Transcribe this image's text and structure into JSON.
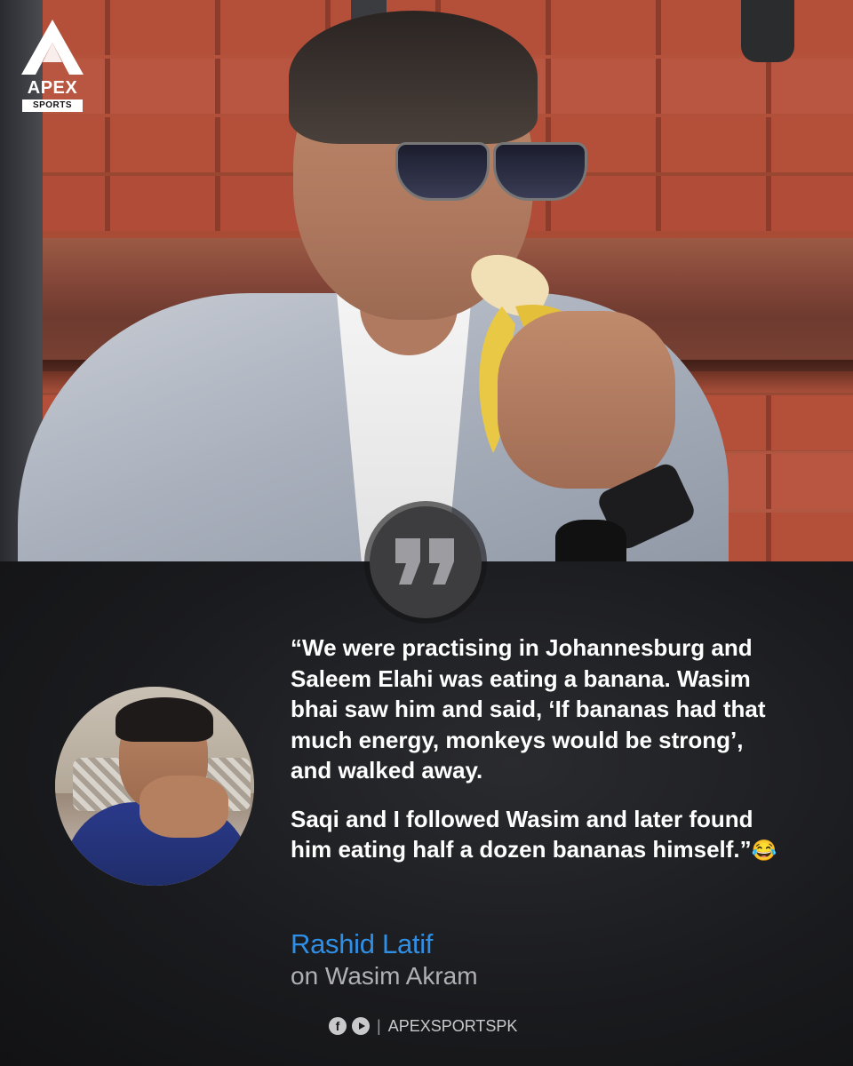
{
  "brand": {
    "logo_main": "APEX",
    "logo_sub": "SPORTS",
    "accent_color": "#2f8fe6"
  },
  "quote": {
    "paragraph_1": "“We were practising in Johannesburg and Saleem Elahi was eating a banana. Wasim bhai saw him and said, ‘If bananas had that much energy, monkeys would be strong’, and walked away.",
    "paragraph_2": "Saqi and I followed Wasim and later found him eating half a dozen bananas himself.”",
    "emoji": "😂"
  },
  "attribution": {
    "name": "Rashid Latif",
    "subtitle": "on Wasim Akram"
  },
  "footer": {
    "facebook_icon_glyph": "f",
    "separator": "|",
    "handle": "APEXSPORTSPK"
  }
}
